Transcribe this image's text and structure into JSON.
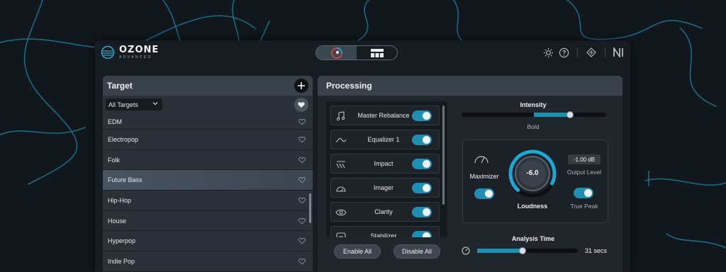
{
  "app": {
    "name": "OZONE",
    "edition": "ADVANCED",
    "colors": {
      "accent": "#1c8fb2",
      "background": "#11171b",
      "panel": "#2a3138"
    }
  },
  "toolbar": {
    "modes": [
      {
        "icon": "assistant-icon",
        "active": true
      },
      {
        "icon": "module-view-icon",
        "active": false
      }
    ],
    "icons": [
      "settings-icon",
      "help-icon",
      "brand-icon",
      "native-instruments-logo"
    ]
  },
  "target": {
    "title": "Target",
    "filter": {
      "selected": "All Targets"
    },
    "items": [
      {
        "label": "EDM",
        "selected": false
      },
      {
        "label": "Electropop",
        "selected": false
      },
      {
        "label": "Folk",
        "selected": false
      },
      {
        "label": "Future Bass",
        "selected": true
      },
      {
        "label": "Hip-Hop",
        "selected": false
      },
      {
        "label": "House",
        "selected": false
      },
      {
        "label": "Hyperpop",
        "selected": false
      },
      {
        "label": "Indie Pop",
        "selected": false
      }
    ]
  },
  "processing": {
    "title": "Processing",
    "modules": [
      {
        "label": "Master Rebalance",
        "icon": "note-icon",
        "enabled": true
      },
      {
        "label": "Equalizer 1",
        "icon": "eq-curve-icon",
        "enabled": true
      },
      {
        "label": "Impact",
        "icon": "impact-icon",
        "enabled": true
      },
      {
        "label": "Imager",
        "icon": "imager-icon",
        "enabled": true
      },
      {
        "label": "Clarity",
        "icon": "eye-icon",
        "enabled": true
      },
      {
        "label": "Stabilizer",
        "icon": "stabilizer-icon",
        "enabled": true
      }
    ],
    "enable_all": "Enable All",
    "disable_all": "Disable All",
    "intensity": {
      "label": "Intensity",
      "value_text": "Bold",
      "level": 0.75
    },
    "maximizer": {
      "label": "Maximizer",
      "enabled": true
    },
    "loudness": {
      "label": "Loudness",
      "value": "-6.0"
    },
    "output_level": {
      "label": "Output Level",
      "value": "-1.00 dB"
    },
    "true_peak": {
      "label": "True Peak",
      "enabled": true
    },
    "analysis_time": {
      "label": "Analysis Time",
      "value_text": "31 secs",
      "level": 0.45
    }
  }
}
